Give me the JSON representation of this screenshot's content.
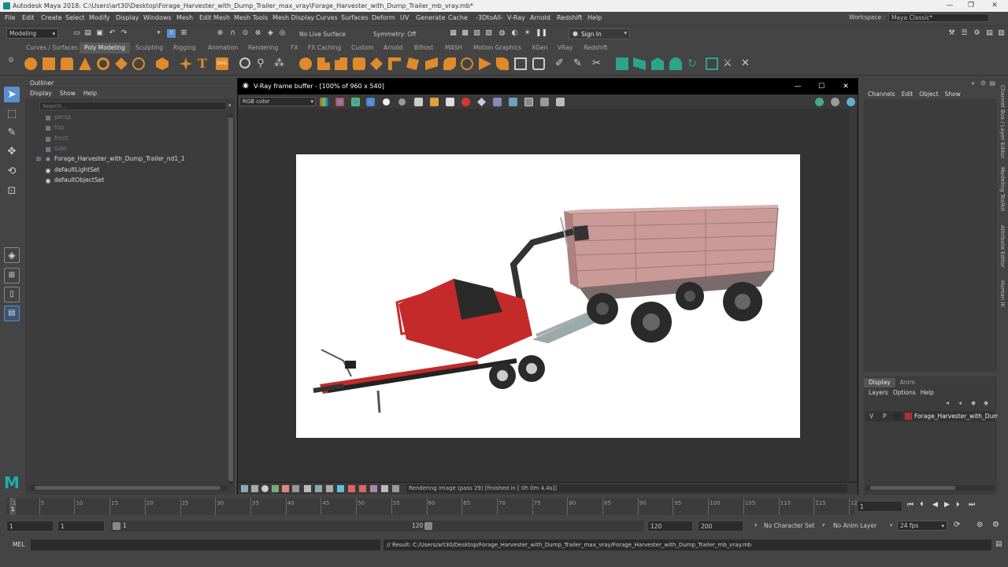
{
  "title_bar": {
    "title": "Autodesk Maya 2018: C:\\Users\\art30\\Desktop\\Forage_Harvester_with_Dump_Trailer_max_vray\\Forage_Harvester_with_Dump_Trailer_mb_vray.mb*",
    "minimize": "—",
    "restore": "❐",
    "close": "✕"
  },
  "menu_bar": [
    "File",
    "Edit",
    "Create",
    "Select",
    "Modify",
    "Display",
    "Windows",
    "Mesh",
    "Edit Mesh",
    "Mesh Tools",
    "Mesh Display",
    "Curves",
    "Surfaces",
    "Deform",
    "UV",
    "Generate",
    "Cache",
    "-3DtoAll-",
    "V-Ray",
    "Arnold",
    "Redshift",
    "Help"
  ],
  "workspace": {
    "label": "Workspace :",
    "value": "Maya Classic*"
  },
  "status_line": {
    "mode": "Modeling",
    "live_surface": "No Live Surface",
    "symmetry": "Symmetry: Off",
    "sign_in": "Sign In"
  },
  "shelf_tabs": [
    "Curves / Surfaces",
    "Poly Modeling",
    "Sculpting",
    "Rigging",
    "Animation",
    "Rendering",
    "FX",
    "FX Caching",
    "Custom",
    "Arnold",
    "Bifrost",
    "MASH",
    "Motion Graphics",
    "XGen",
    "VRay",
    "Redshift"
  ],
  "shelf_active": "Poly Modeling",
  "outliner": {
    "title": "Outliner",
    "menu": [
      "Display",
      "Show",
      "Help"
    ],
    "search_placeholder": "Search...",
    "items": [
      {
        "label": "persp",
        "dim": true,
        "icon": "camera-icon"
      },
      {
        "label": "top",
        "dim": true,
        "icon": "camera-icon"
      },
      {
        "label": "front",
        "dim": true,
        "icon": "camera-icon"
      },
      {
        "label": "side",
        "dim": true,
        "icon": "camera-icon"
      },
      {
        "label": "Forage_Harvester_with_Dump_Trailer_nd1_1",
        "dim": false,
        "icon": "group-icon",
        "expandable": true
      },
      {
        "label": "defaultLightSet",
        "dim": false,
        "icon": "set-icon"
      },
      {
        "label": "defaultObjectSet",
        "dim": false,
        "icon": "set-icon"
      }
    ]
  },
  "vray": {
    "title": "V-Ray frame buffer - [100% of 960 x 540]",
    "channel": "RGB color",
    "status": "Rendering image (pass 29) [finished in [ 0h  0m  4.4s]]"
  },
  "channel_box": {
    "menu": [
      "Channels",
      "Edit",
      "Object",
      "Show"
    ]
  },
  "layer_editor": {
    "tabs": [
      "Display",
      "Anim"
    ],
    "menu": [
      "Layers",
      "Options",
      "Help"
    ],
    "layer": {
      "v": "V",
      "p": "P",
      "name": "Forage_Harvester_with_Dump_",
      "color": "#b0303a"
    }
  },
  "side_tabs": [
    "Channel Box / Layer Editor",
    "Modeling Toolkit",
    "Attribute Editor",
    "Human IK"
  ],
  "timeline": {
    "ticks": [
      "1",
      "5",
      "10",
      "15",
      "20",
      "25",
      "30",
      "35",
      "40",
      "45",
      "50",
      "55",
      "60",
      "65",
      "70",
      "75",
      "80",
      "85",
      "90",
      "95",
      "100",
      "105",
      "110",
      "115",
      "120"
    ],
    "current_frame": "1"
  },
  "range": {
    "start": "1",
    "start2": "1",
    "slider_start": "1",
    "slider_end": "120",
    "end": "120",
    "end2": "200",
    "character_set": "No Character Set",
    "anim_layer": "No Anim Layer",
    "fps": "24 fps"
  },
  "command_line": {
    "mode": "MEL",
    "result": "// Result: C:/Users/art30/Desktop/Forage_Harvester_with_Dump_Trailer_max_vray/Forage_Harvester_with_Dump_Trailer_mb_vray.mb"
  },
  "colors": {
    "accent": "#5a8fd0",
    "shelf_orange": "#e08a2a",
    "shelf_green": "#2aa58a",
    "maya_teal": "#1ab0b0"
  }
}
